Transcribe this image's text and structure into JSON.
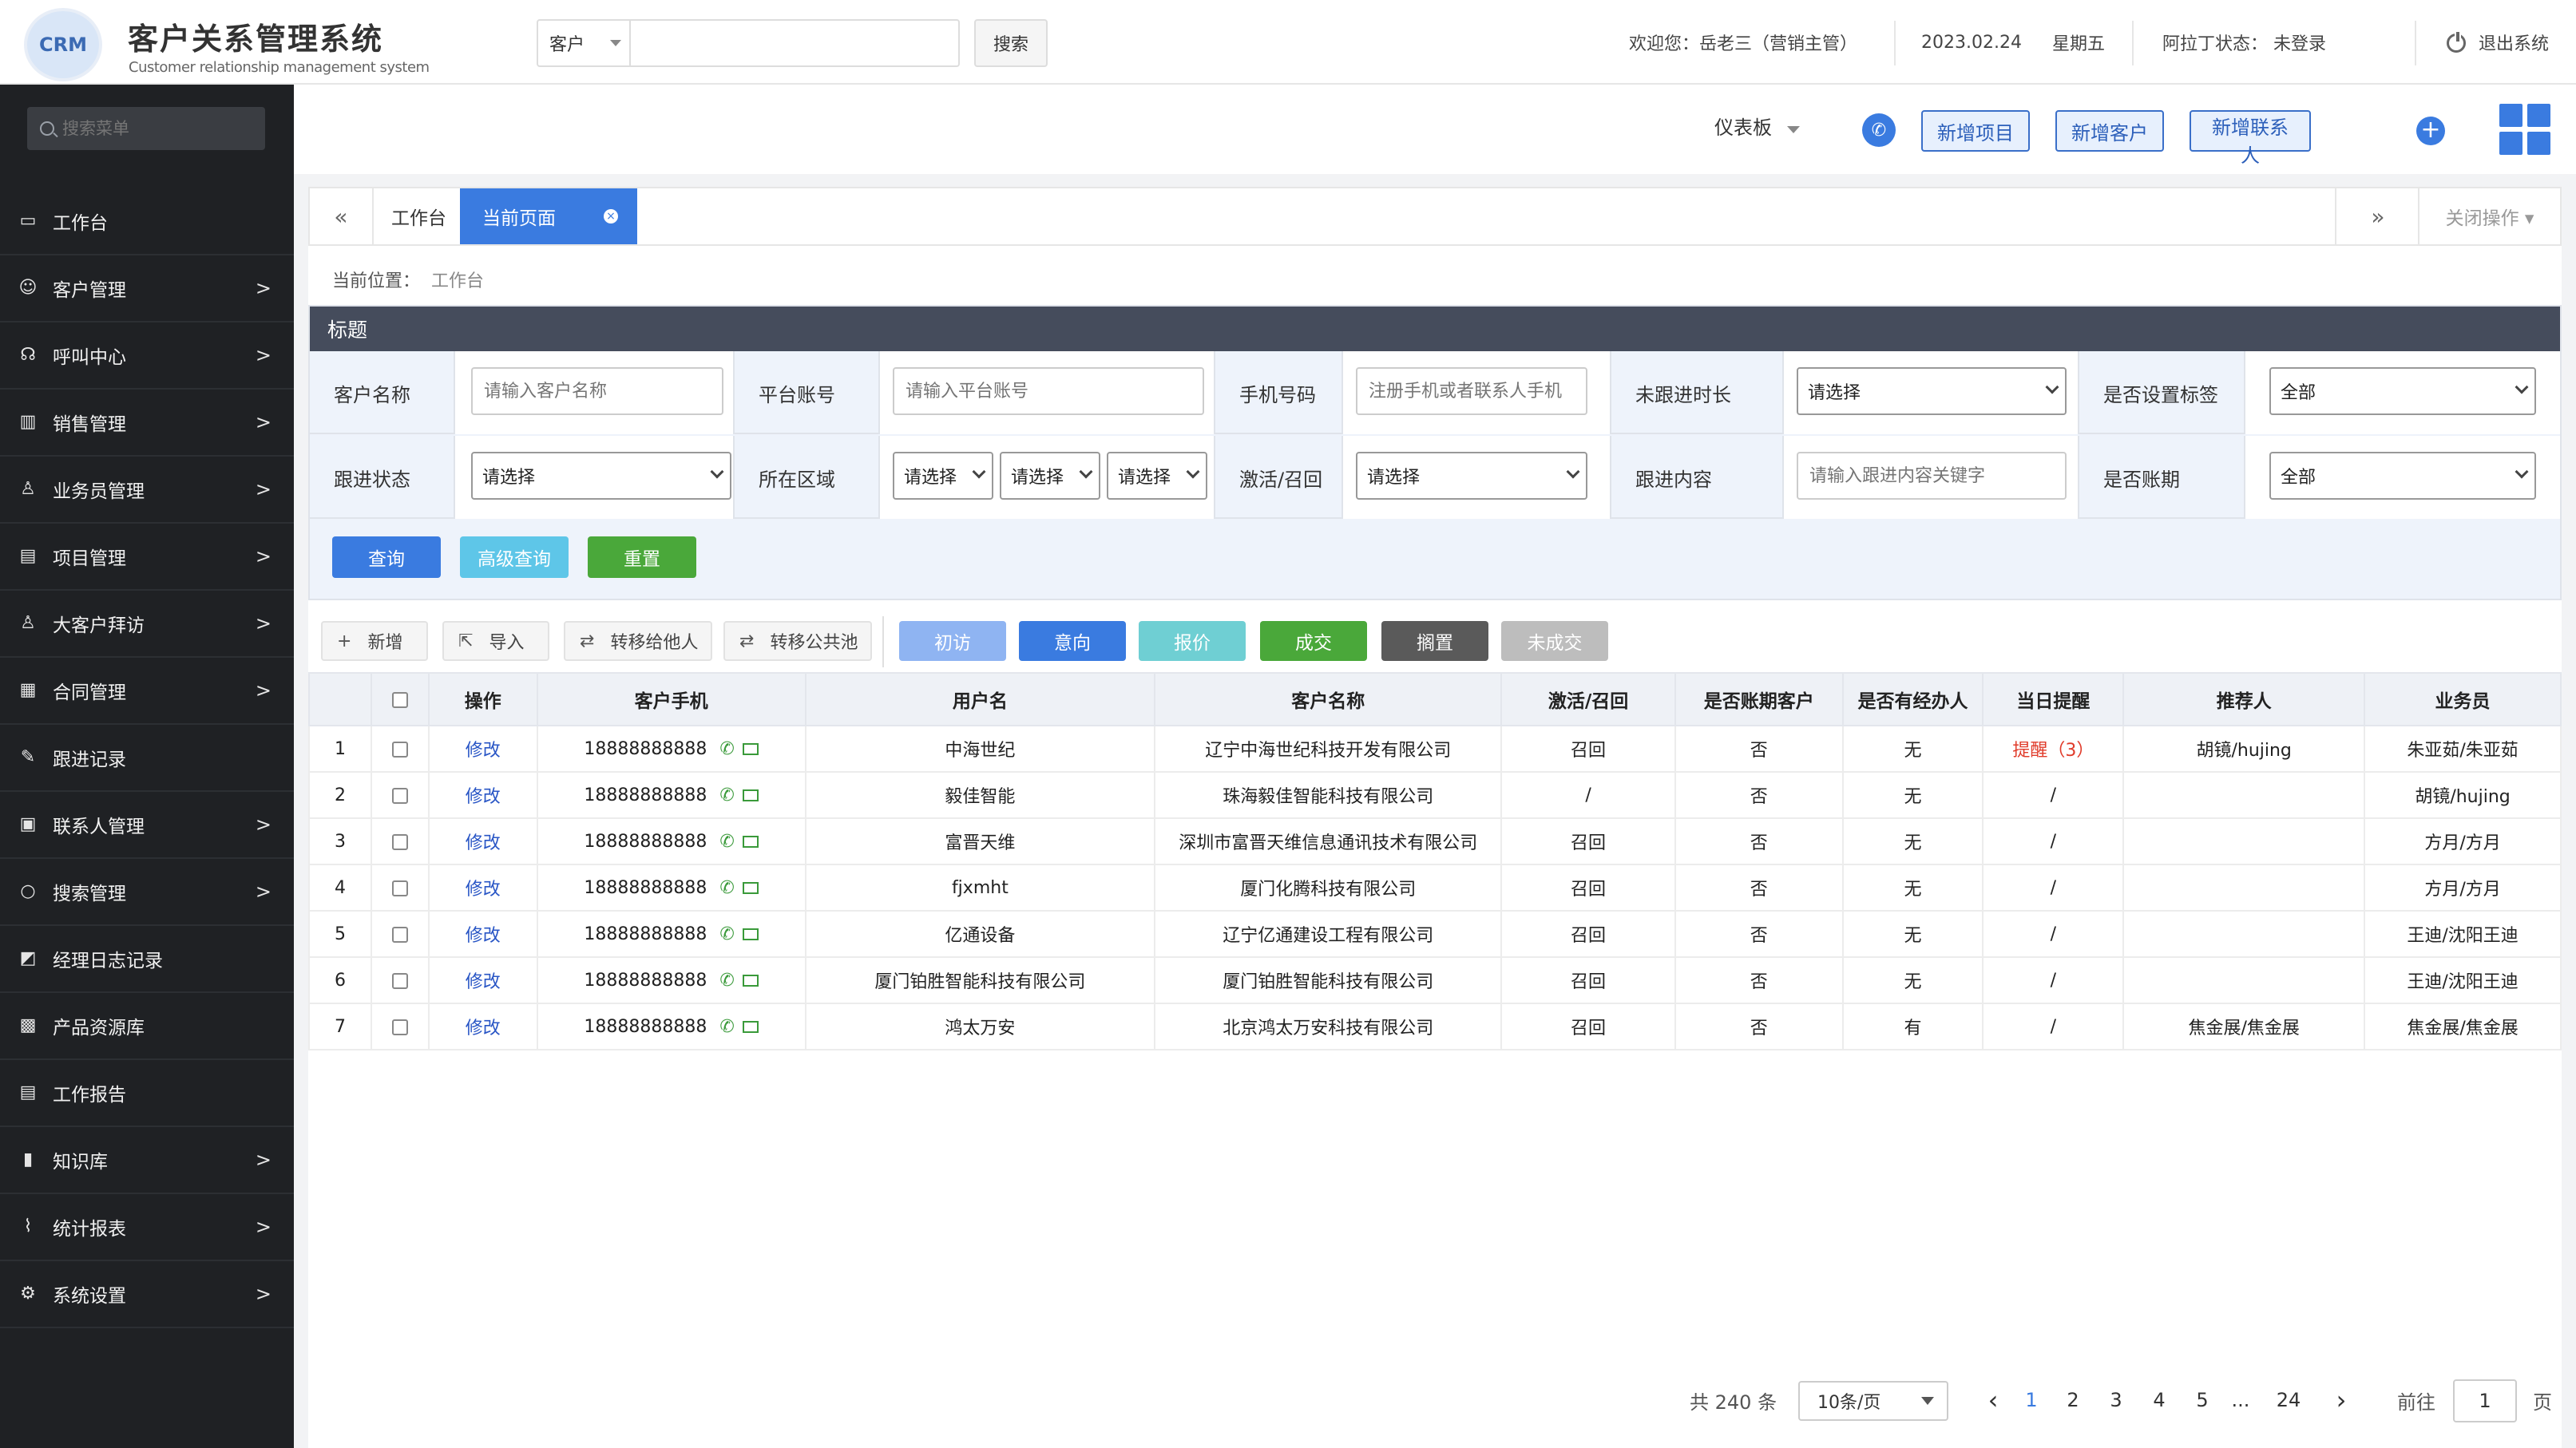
{
  "header": {
    "logo_text": "CRM",
    "title": "客户关系管理系统",
    "subtitle": "Customer relationship management system",
    "search_type": "客户",
    "search_placeholder": "",
    "search_button": "搜索",
    "welcome": "欢迎您：岳老三（营销主管）",
    "date": "2023.02.24",
    "weekday": "星期五",
    "aladdin_status": "阿拉丁状态：  未登录",
    "logout": "退出系统"
  },
  "sidebar": {
    "search_placeholder": "搜索菜单",
    "items": [
      {
        "label": "工作台",
        "icon": "monitor-chart-icon",
        "glyph": "▭",
        "has_arrow": false
      },
      {
        "label": "客户管理",
        "icon": "users-icon",
        "glyph": "☺",
        "has_arrow": true
      },
      {
        "label": "呼叫中心",
        "icon": "headset-icon",
        "glyph": "☊",
        "has_arrow": true
      },
      {
        "label": "销售管理",
        "icon": "bar-chart-icon",
        "glyph": "▥",
        "has_arrow": true
      },
      {
        "label": "业务员管理",
        "icon": "staff-icon",
        "glyph": "♙",
        "has_arrow": true
      },
      {
        "label": "项目管理",
        "icon": "project-icon",
        "glyph": "▤",
        "has_arrow": true
      },
      {
        "label": "大客户拜访",
        "icon": "visit-user-icon",
        "glyph": "♙",
        "has_arrow": true
      },
      {
        "label": "合同管理",
        "icon": "contract-icon",
        "glyph": "▦",
        "has_arrow": true
      },
      {
        "label": "跟进记录",
        "icon": "pen-icon",
        "glyph": "✎",
        "has_arrow": false
      },
      {
        "label": "联系人管理",
        "icon": "contacts-icon",
        "glyph": "▣",
        "has_arrow": true
      },
      {
        "label": "搜索管理",
        "icon": "search-icon",
        "glyph": "○",
        "has_arrow": true
      },
      {
        "label": "经理日志记录",
        "icon": "log-icon",
        "glyph": "◩",
        "has_arrow": false
      },
      {
        "label": "产品资源库",
        "icon": "grid-apps-icon",
        "glyph": "▩",
        "has_arrow": false
      },
      {
        "label": "工作报告",
        "icon": "report-icon",
        "glyph": "▤",
        "has_arrow": false
      },
      {
        "label": "知识库",
        "icon": "book-icon",
        "glyph": "▮",
        "has_arrow": true
      },
      {
        "label": "统计报表",
        "icon": "stats-icon",
        "glyph": "⌇",
        "has_arrow": true
      },
      {
        "label": "系统设置",
        "icon": "gear-icon",
        "glyph": "⚙",
        "has_arrow": true
      }
    ],
    "arrow": ">"
  },
  "topbar": {
    "dashboard": "仪表板",
    "btn_new_project": "新增项目",
    "btn_new_customer": "新增客户",
    "btn_new_contact": "新增联系人",
    "phone_glyph": "✆",
    "plus_glyph": "+"
  },
  "tabs": {
    "prev": "«",
    "next": "»",
    "items": [
      "工作台",
      "当前页面"
    ],
    "close_glyph": "×",
    "close_ops": "关闭操作 ▾"
  },
  "breadcrumb": {
    "label": "当前位置：",
    "current": "工作台"
  },
  "form": {
    "title": "标题",
    "row1": {
      "customer_name_label": "客户名称",
      "customer_name_placeholder": "请输入客户名称",
      "platform_label": "平台账号",
      "platform_placeholder": "请输入平台账号",
      "phone_label": "手机号码",
      "phone_placeholder": "注册手机或者联系人手机",
      "no_follow_label": "未跟进时长",
      "no_follow_value": "请选择",
      "tag_label": "是否设置标签",
      "tag_value": "全部"
    },
    "row2": {
      "follow_status_label": "跟进状态",
      "follow_status_value": "请选择",
      "region_label": "所在区域",
      "region_values": [
        "请选择",
        "请选择",
        "请选择"
      ],
      "activate_label": "激活/召回",
      "activate_value": "请选择",
      "follow_content_label": "跟进内容",
      "follow_content_placeholder": "请输入跟进内容关键字",
      "account_period_label": "是否账期",
      "account_period_value": "全部"
    },
    "buttons": {
      "query": "查询",
      "advanced": "高级查询",
      "reset": "重置"
    }
  },
  "actions": {
    "add": "新增",
    "import": "导入",
    "transfer_other": "转移给他人",
    "transfer_pool": "转移公共池",
    "status": [
      {
        "label": "初访",
        "color": "#8fb4f2"
      },
      {
        "label": "意向",
        "color": "#3a7be0"
      },
      {
        "label": "报价",
        "color": "#6fcfd3"
      },
      {
        "label": "成交",
        "color": "#4aa83a"
      },
      {
        "label": "搁置",
        "color": "#5a5a5a"
      },
      {
        "label": "未成交",
        "color": "#bdbdbd"
      }
    ]
  },
  "table": {
    "headers": [
      "",
      "",
      "操作",
      "客户手机",
      "用户名",
      "客户名称",
      "激活/召回",
      "是否账期客户",
      "是否有经办人",
      "当日提醒",
      "推荐人",
      "业务员"
    ],
    "edit_label": "修改",
    "rows": [
      {
        "no": "1",
        "phone": "18888888888",
        "user": "中海世纪",
        "company": "辽宁中海世纪科技开发有限公司",
        "activate": "召回",
        "period": "否",
        "agent": "无",
        "remind": "提醒（3）",
        "referrer": "胡镜/hujing",
        "sales": "朱亚茹/朱亚茹"
      },
      {
        "no": "2",
        "phone": "18888888888",
        "user": "毅佳智能",
        "company": "珠海毅佳智能科技有限公司",
        "activate": "/",
        "period": "否",
        "agent": "无",
        "remind": "/",
        "referrer": "",
        "sales": "胡镜/hujing"
      },
      {
        "no": "3",
        "phone": "18888888888",
        "user": "富晋天维",
        "company": "深圳市富晋天维信息通讯技术有限公司",
        "activate": "召回",
        "period": "否",
        "agent": "无",
        "remind": "/",
        "referrer": "",
        "sales": "方月/方月"
      },
      {
        "no": "4",
        "phone": "18888888888",
        "user": "fjxmht",
        "company": "厦门化腾科技有限公司",
        "activate": "召回",
        "period": "否",
        "agent": "无",
        "remind": "/",
        "referrer": "",
        "sales": "方月/方月"
      },
      {
        "no": "5",
        "phone": "18888888888",
        "user": "亿通设备",
        "company": "辽宁亿通建设工程有限公司",
        "activate": "召回",
        "period": "否",
        "agent": "无",
        "remind": "/",
        "referrer": "",
        "sales": "王迪/沈阳王迪"
      },
      {
        "no": "6",
        "phone": "18888888888",
        "user": "厦门铂胜智能科技有限公司",
        "company": "厦门铂胜智能科技有限公司",
        "activate": "召回",
        "period": "否",
        "agent": "无",
        "remind": "/",
        "referrer": "",
        "sales": "王迪/沈阳王迪"
      },
      {
        "no": "7",
        "phone": "18888888888",
        "user": "鸿太万安",
        "company": "北京鸿太万安科技有限公司",
        "activate": "召回",
        "period": "否",
        "agent": "有",
        "remind": "/",
        "referrer": "焦金展/焦金展",
        "sales": "焦金展/焦金展"
      }
    ]
  },
  "pagination": {
    "total": "共 240 条",
    "page_size": "10条/页",
    "prev": "‹",
    "next": "›",
    "pages": [
      "1",
      "2",
      "3",
      "4",
      "5",
      "...",
      "24"
    ],
    "current": "1",
    "goto_label": "前往",
    "goto_value": "1",
    "page_suffix": "页"
  }
}
